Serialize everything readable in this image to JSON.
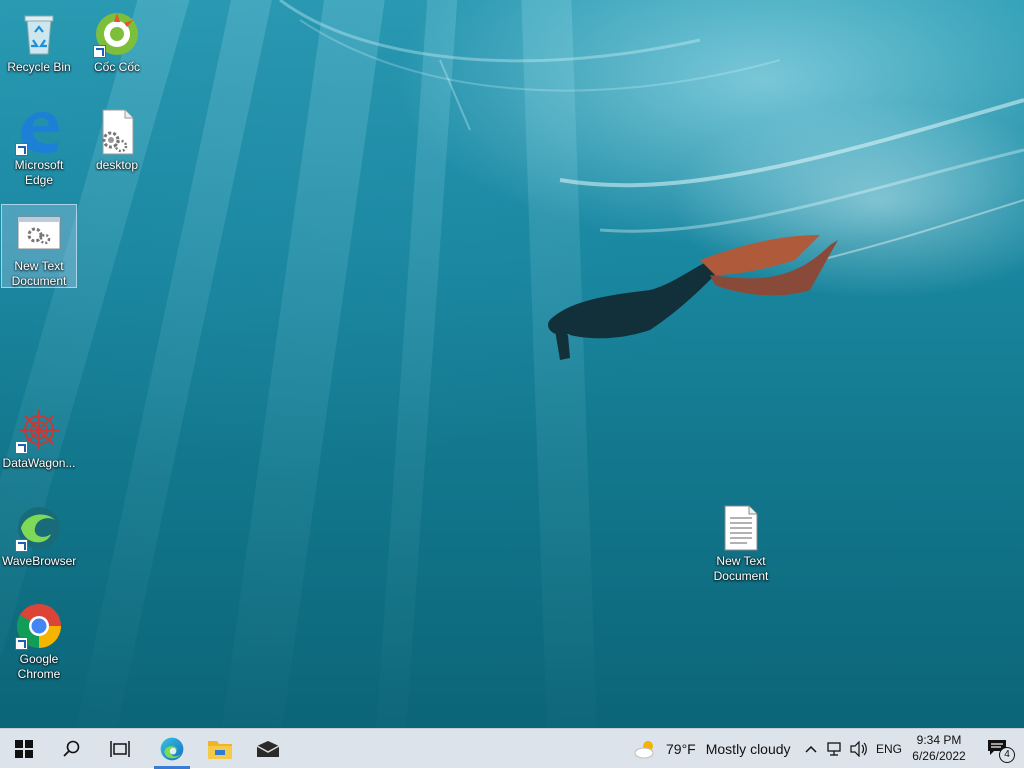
{
  "desktop": {
    "icons": [
      {
        "label": "Recycle Bin"
      },
      {
        "label": "Cốc Cốc"
      },
      {
        "label": "Microsoft Edge"
      },
      {
        "label": "desktop"
      },
      {
        "label": "New Text Document"
      },
      {
        "label": "DataWagon..."
      },
      {
        "label": "WaveBrowser"
      },
      {
        "label": "Google Chrome"
      },
      {
        "label": "New Text Document"
      }
    ]
  },
  "taskbar": {
    "start_icon": "windows-logo-icon",
    "search_icon": "search-icon",
    "task_view_icon": "task-view-icon",
    "pinned": [
      {
        "name": "edge-icon",
        "active": true
      },
      {
        "name": "file-explorer-icon",
        "active": false
      },
      {
        "name": "mail-icon",
        "active": false
      }
    ],
    "weather": {
      "temp": "79°F",
      "condition": "Mostly cloudy"
    },
    "tray": {
      "language": "ENG"
    },
    "clock": {
      "time": "9:34 PM",
      "date": "6/26/2022"
    },
    "notifications": {
      "count": "4"
    },
    "accent": "#3a7bd5"
  }
}
